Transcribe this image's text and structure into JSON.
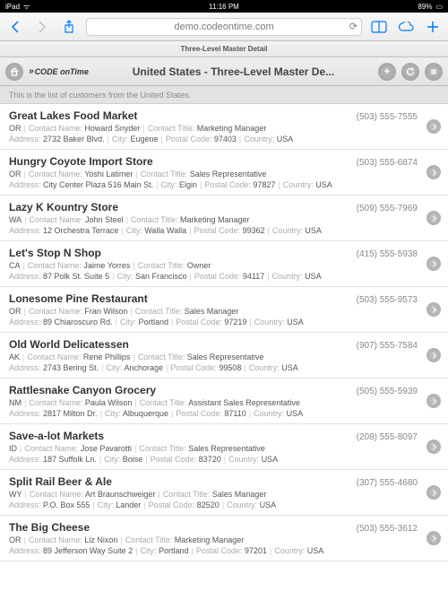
{
  "status": {
    "device": "iPad",
    "wifi": "ᯤ",
    "time": "11:16 PM",
    "battery_pct": "89%",
    "battery_glyph": "▭"
  },
  "safari": {
    "url": "demo.codeontime.com",
    "tab_title": "Three-Level Master Detail"
  },
  "header": {
    "logo_text": "CODE onTime",
    "title": "United States - Three-Level Master De..."
  },
  "subheader": "This is the list of customers from the United States.",
  "labels": {
    "contact_name": "Contact Name:",
    "contact_title": "Contact Title:",
    "address": "Address:",
    "city": "City:",
    "postal": "Postal Code:",
    "country": "Country:"
  },
  "customers": [
    {
      "name": "Great Lakes Food Market",
      "phone": "(503) 555-7555",
      "state": "OR",
      "contact": "Howard Snyder",
      "title": "Marketing Manager",
      "address": "2732 Baker Blvd.",
      "city": "Eugene",
      "postal": "97403",
      "country": "USA"
    },
    {
      "name": "Hungry Coyote Import Store",
      "phone": "(503) 555-6874",
      "state": "OR",
      "contact": "Yoshi Latimer",
      "title": "Sales Representative",
      "address": "City Center Plaza 516 Main St.",
      "city": "Elgin",
      "postal": "97827",
      "country": "USA"
    },
    {
      "name": "Lazy K Kountry Store",
      "phone": "(509) 555-7969",
      "state": "WA",
      "contact": "John Steel",
      "title": "Marketing Manager",
      "address": "12 Orchestra Terrace",
      "city": "Walla Walla",
      "postal": "99362",
      "country": "USA"
    },
    {
      "name": "Let's Stop N Shop",
      "phone": "(415) 555-5938",
      "state": "CA",
      "contact": "Jaime Yorres",
      "title": "Owner",
      "address": "87 Polk St. Suite 5",
      "city": "San Francisco",
      "postal": "94117",
      "country": "USA"
    },
    {
      "name": "Lonesome Pine Restaurant",
      "phone": "(503) 555-9573",
      "state": "OR",
      "contact": "Fran Wilson",
      "title": "Sales Manager",
      "address": "89 Chiaroscuro Rd.",
      "city": "Portland",
      "postal": "97219",
      "country": "USA"
    },
    {
      "name": "Old World Delicatessen",
      "phone": "(907) 555-7584",
      "state": "AK",
      "contact": "Rene Phillips",
      "title": "Sales Representative",
      "address": "2743 Bering St.",
      "city": "Anchorage",
      "postal": "99508",
      "country": "USA"
    },
    {
      "name": "Rattlesnake Canyon Grocery",
      "phone": "(505) 555-5939",
      "state": "NM",
      "contact": "Paula Wilson",
      "title": "Assistant Sales Representative",
      "address": "2817 Milton Dr.",
      "city": "Albuquerque",
      "postal": "87110",
      "country": "USA"
    },
    {
      "name": "Save-a-lot Markets",
      "phone": "(208) 555-8097",
      "state": "ID",
      "contact": "Jose Pavarotti",
      "title": "Sales Representative",
      "address": "187 Suffolk Ln.",
      "city": "Boise",
      "postal": "83720",
      "country": "USA"
    },
    {
      "name": "Split Rail Beer & Ale",
      "phone": "(307) 555-4680",
      "state": "WY",
      "contact": "Art Braunschweiger",
      "title": "Sales Manager",
      "address": "P.O. Box 555",
      "city": "Lander",
      "postal": "82520",
      "country": "USA"
    },
    {
      "name": "The Big Cheese",
      "phone": "(503) 555-3612",
      "state": "OR",
      "contact": "Liz Nixon",
      "title": "Marketing Manager",
      "address": "89 Jefferson Way Suite 2",
      "city": "Portland",
      "postal": "97201",
      "country": "USA"
    }
  ]
}
